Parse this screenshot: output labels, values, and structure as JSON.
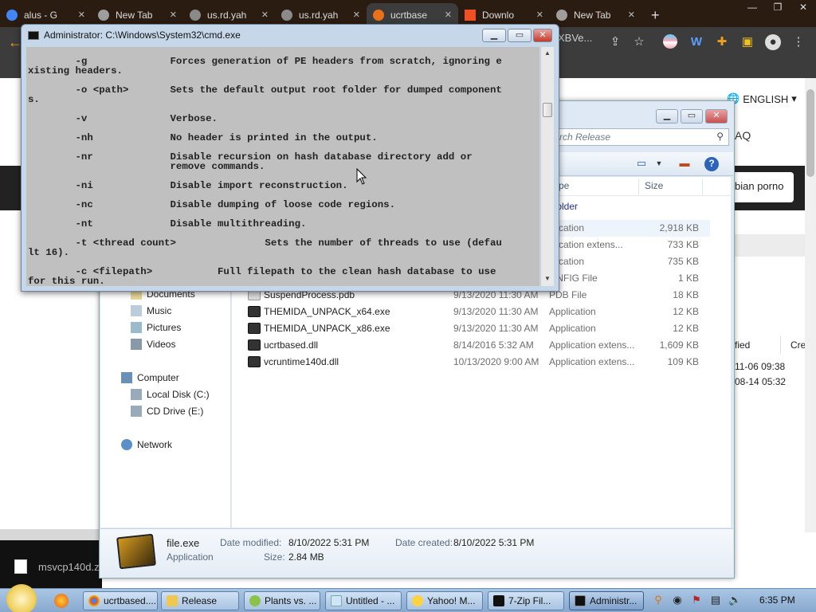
{
  "browser": {
    "tabs": [
      {
        "label": "alus - G",
        "color": "#4285f4",
        "active": false
      },
      {
        "label": "New Tab",
        "color": "#9e9e9e",
        "active": false
      },
      {
        "label": "us.rd.yah",
        "color": "#8a8a8a",
        "active": false
      },
      {
        "label": "us.rd.yah",
        "color": "#8a8a8a",
        "active": false
      },
      {
        "label": "ucrtbase",
        "color": "#e8711a",
        "active": true
      },
      {
        "label": "Downlo",
        "color": "#f25022",
        "active": false
      },
      {
        "label": "New Tab",
        "color": "#9e9e9e",
        "active": false
      }
    ],
    "new_tab": "+",
    "window_controls": [
      "—",
      "❐",
      "✕"
    ],
    "omnibox_fragment": "XBVe...",
    "page": {
      "language": "ENGLISH",
      "faq_fragment": "AQ",
      "search_fragment": "bian porno",
      "right_table": {
        "headers": [
          "fied",
          "Create"
        ],
        "rows": [
          "11-06 09:38",
          "08-14 05:32"
        ]
      },
      "download_name": "msvcp140d.z"
    }
  },
  "cmd": {
    "title": "Administrator: C:\\Windows\\System32\\cmd.exe",
    "lines": [
      "        -g              Forces generation of PE headers from scratch, ignoring e",
      "xisting headers.",
      "        -o <path>       Sets the default output root folder for dumped component",
      "s.",
      "        -v              Verbose.",
      "        -nh             No header is printed in the output.",
      "        -nr             Disable recursion on hash database directory add or",
      "                        remove commands.",
      "        -ni             Disable import reconstruction.",
      "        -nc             Disable dumping of loose code regions.",
      "        -nt             Disable multithreading.",
      "        -t <thread count>               Sets the number of threads to use (defau",
      "lt 16).",
      "        -c <filepath>           Full filepath to the clean hash database to use",
      "for this run."
    ]
  },
  "explorer": {
    "search_placeholder": "rch Release",
    "columns": {
      "type": "pe",
      "size": "Size"
    },
    "group_header": "e folder",
    "nav": {
      "documents": "Documents",
      "music": "Music",
      "pictures": "Pictures",
      "videos": "Videos",
      "computer": "Computer",
      "local_disk": "Local Disk (C:)",
      "cd_drive": "CD Drive (E:)",
      "network": "Network"
    },
    "files": [
      {
        "name": "",
        "date": "",
        "type": "plication",
        "size": "2,918 KB"
      },
      {
        "name": "",
        "date": "",
        "type": "plication extens...",
        "size": "733 KB"
      },
      {
        "name": "",
        "date": "",
        "type": "plication",
        "size": "735 KB"
      },
      {
        "name": "",
        "date": "",
        "type": "ONFIG File",
        "size": "1 KB"
      },
      {
        "name": "SuspendProcess.pdb",
        "date": "9/13/2020 11:30 AM",
        "type": "PDB File",
        "size": "18 KB"
      },
      {
        "name": "THEMIDA_UNPACK_x64.exe",
        "date": "9/13/2020 11:30 AM",
        "type": "Application",
        "size": "12 KB"
      },
      {
        "name": "THEMIDA_UNPACK_x86.exe",
        "date": "9/13/2020 11:30 AM",
        "type": "Application",
        "size": "12 KB"
      },
      {
        "name": "ucrtbased.dll",
        "date": "8/14/2016 5:32 AM",
        "type": "Application extens...",
        "size": "1,609 KB"
      },
      {
        "name": "vcruntime140d.dll",
        "date": "10/13/2020 9:00 AM",
        "type": "Application extens...",
        "size": "109 KB"
      }
    ],
    "details": {
      "name": "file.exe",
      "kind": "Application",
      "modified_label": "Date modified:",
      "modified_value": "8/10/2022 5:31 PM",
      "created_label": "Date created:",
      "created_value": "8/10/2022 5:31 PM",
      "size_label": "Size:",
      "size_value": "2.84 MB"
    }
  },
  "taskbar": {
    "tasks": [
      {
        "label": "ucrtbased....",
        "icon": "chrome-icon"
      },
      {
        "label": "Release",
        "icon": "folder-icon"
      },
      {
        "label": "Plants vs. ...",
        "icon": "game-icon"
      },
      {
        "label": "Untitled - ...",
        "icon": "notepad-icon"
      },
      {
        "label": "Yahoo! M...",
        "icon": "messenger-icon"
      },
      {
        "label": "7-Zip Fil...",
        "icon": "7zip-icon"
      },
      {
        "label": "Administr...",
        "icon": "cmd-icon"
      }
    ],
    "clock": "6:35 PM"
  }
}
